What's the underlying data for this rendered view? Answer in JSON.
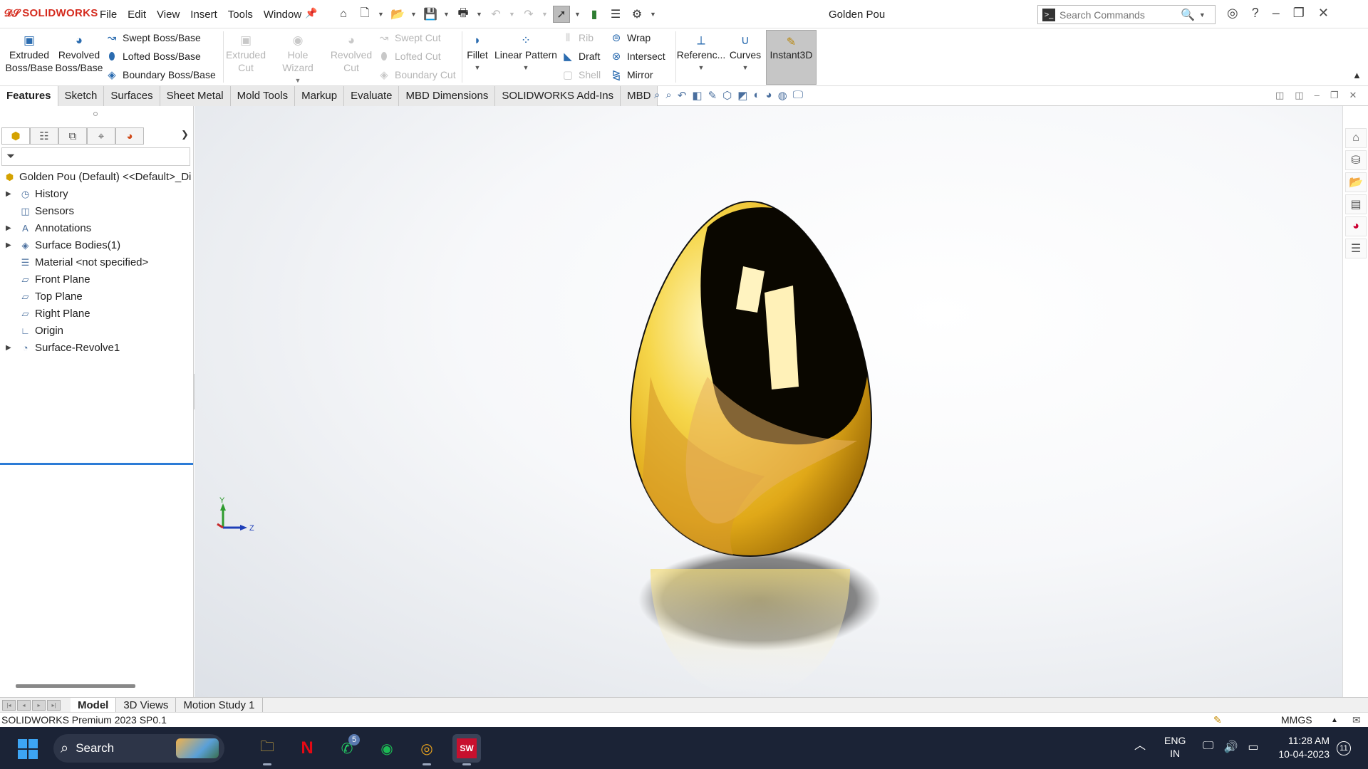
{
  "app": {
    "logo_text": "SOLIDWORKS",
    "doc_title": "Golden Pou",
    "menu": [
      "File",
      "Edit",
      "View",
      "Insert",
      "Tools",
      "Window"
    ],
    "search_placeholder": "Search Commands"
  },
  "ribbon": {
    "extruded_boss": [
      "Extruded",
      "Boss/Base"
    ],
    "revolved_boss": [
      "Revolved",
      "Boss/Base"
    ],
    "swept_boss": "Swept Boss/Base",
    "lofted_boss": "Lofted Boss/Base",
    "boundary_boss": "Boundary Boss/Base",
    "extruded_cut": [
      "Extruded",
      "Cut"
    ],
    "hole_wizard": "Hole Wizard",
    "revolved_cut": [
      "Revolved",
      "Cut"
    ],
    "swept_cut": "Swept Cut",
    "lofted_cut": "Lofted Cut",
    "boundary_cut": "Boundary Cut",
    "fillet": "Fillet",
    "linear_pattern": "Linear Pattern",
    "rib": "Rib",
    "draft": "Draft",
    "shell": "Shell",
    "wrap": "Wrap",
    "intersect": "Intersect",
    "mirror": "Mirror",
    "reference": "Referenc...",
    "curves": "Curves",
    "instant3d": "Instant3D"
  },
  "tabs": [
    {
      "label": "Features",
      "active": true
    },
    {
      "label": "Sketch"
    },
    {
      "label": "Surfaces"
    },
    {
      "label": "Sheet Metal"
    },
    {
      "label": "Mold Tools"
    },
    {
      "label": "Markup"
    },
    {
      "label": "Evaluate"
    },
    {
      "label": "MBD Dimensions"
    },
    {
      "label": "SOLIDWORKS Add-Ins"
    },
    {
      "label": "MBD"
    }
  ],
  "tree": {
    "root": "Golden Pou (Default) <<Default>_Di",
    "items": [
      {
        "label": "History",
        "icon": "history-icon"
      },
      {
        "label": "Sensors",
        "icon": "sensors-icon"
      },
      {
        "label": "Annotations",
        "icon": "annotations-icon"
      },
      {
        "label": "Surface Bodies(1)",
        "icon": "surface-bodies-icon"
      },
      {
        "label": "Material <not specified>",
        "icon": "material-icon"
      },
      {
        "label": "Front Plane",
        "icon": "plane-icon"
      },
      {
        "label": "Top Plane",
        "icon": "plane-icon"
      },
      {
        "label": "Right Plane",
        "icon": "plane-icon"
      },
      {
        "label": "Origin",
        "icon": "origin-icon"
      },
      {
        "label": "Surface-Revolve1",
        "icon": "surface-revolve-icon"
      }
    ]
  },
  "triad": {
    "y": "Y",
    "z": "Z"
  },
  "bottom_tabs": [
    {
      "label": "Model",
      "active": true
    },
    {
      "label": "3D Views"
    },
    {
      "label": "Motion Study 1"
    }
  ],
  "status": {
    "text": "SOLIDWORKS Premium 2023 SP0.1",
    "units": "MMGS"
  },
  "taskbar": {
    "search": "Search",
    "whatsapp_badge": "5",
    "lang": [
      "ENG",
      "IN"
    ],
    "time": "11:28 AM",
    "date": "10-04-2023",
    "notifications": "11"
  },
  "colors": {
    "accent": "#2c7bd6",
    "logo": "#d52b1e",
    "gold": "#f2cf3a",
    "taskbar": "#1b2336"
  }
}
